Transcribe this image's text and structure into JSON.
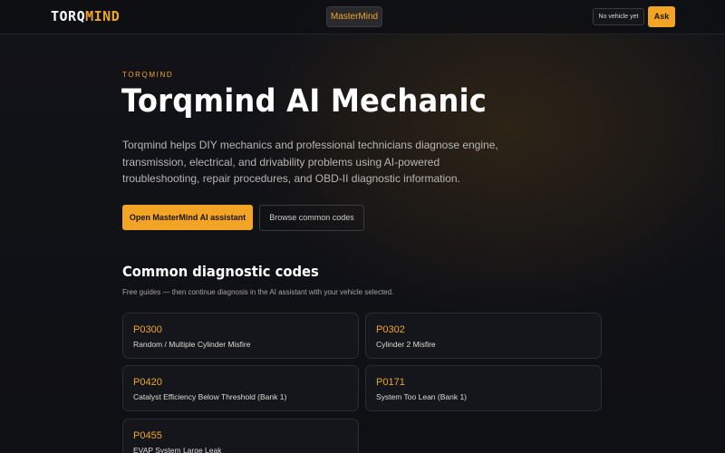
{
  "header": {
    "logo_part1": "TORQ",
    "logo_part2": "MIND",
    "center_button": "MasterMind",
    "vehicle_button": "No vehicle yet",
    "ask_button": "Ask"
  },
  "hero": {
    "eyebrow": "TORQMIND",
    "title": "Torqmind AI Mechanic",
    "description": "Torqmind helps DIY mechanics and professional technicians diagnose engine, transmission, electrical, and drivability problems using AI-powered troubleshooting, repair procedures, and OBD-II diagnostic information.",
    "primary_button": "Open MasterMind AI assistant",
    "secondary_button": "Browse common codes"
  },
  "codes_section": {
    "title": "Common diagnostic codes",
    "subtitle": "Free guides — then continue diagnosis in the AI assistant with your vehicle selected.",
    "cards": [
      {
        "code": "P0300",
        "desc": "Random / Multiple Cylinder Misfire"
      },
      {
        "code": "P0302",
        "desc": "Cylinder 2 Misfire"
      },
      {
        "code": "P0420",
        "desc": "Catalyst Efficiency Below Threshold (Bank 1)"
      },
      {
        "code": "P0171",
        "desc": "System Too Lean (Bank 1)"
      },
      {
        "code": "P0455",
        "desc": "EVAP System Large Leak"
      }
    ]
  },
  "colors": {
    "accent": "#f2a424",
    "background": "#0f1014",
    "card_background": "#15161b"
  }
}
